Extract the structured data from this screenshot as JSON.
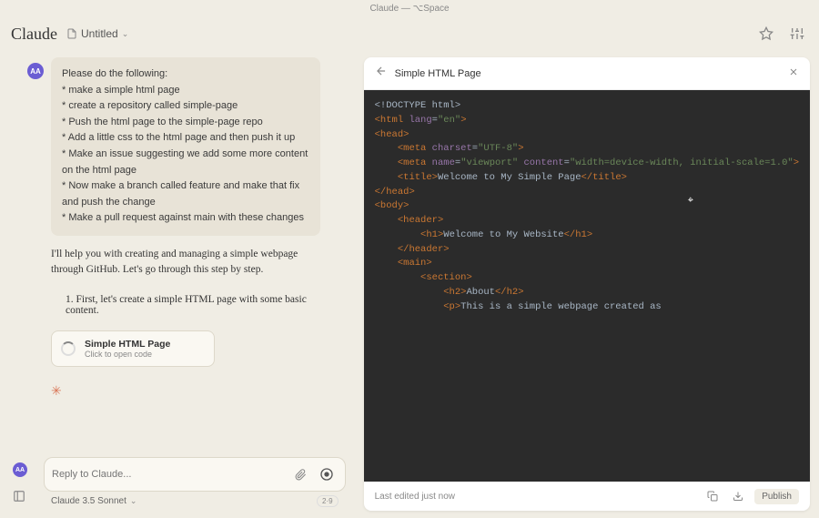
{
  "window_title": "Claude — ⌥Space",
  "header": {
    "logo": "Claude",
    "doc_title": "Untitled"
  },
  "user_message": {
    "avatar": "AA",
    "intro": "Please do the following:",
    "items": [
      "* make a simple html page",
      "* create a repository called simple-page",
      "* Push the html page to the simple-page repo",
      "* Add a little css to the html page and then push it up",
      "* Make an issue suggesting we add some more content on the html page",
      "* Now make a branch called feature and make that fix and push the change",
      "* Make a pull request against main with these changes"
    ]
  },
  "assistant": {
    "p1": "I'll help you with creating and managing a simple webpage through GitHub. Let's go through this step by step.",
    "list_item_1": "1. First, let's create a simple HTML page with some basic content."
  },
  "code_card": {
    "title": "Simple HTML Page",
    "subtitle": "Click to open code"
  },
  "composer": {
    "placeholder": "Reply to Claude...",
    "avatar": "AA",
    "model": "Claude 3.5 Sonnet",
    "count": "2·9"
  },
  "panel": {
    "title": "Simple HTML Page",
    "footer": "Last edited just now",
    "publish": "Publish"
  },
  "code": {
    "l1_a": "<!DOCTYPE html>",
    "l2_a": "<",
    "l2_b": "html",
    "l2_c": " lang",
    "l2_d": "=",
    "l2_e": "\"en\"",
    "l2_f": ">",
    "l3_a": "<",
    "l3_b": "head",
    "l3_c": ">",
    "l4_a": "<",
    "l4_b": "meta",
    "l4_c": " charset",
    "l4_d": "=",
    "l4_e": "\"UTF-8\"",
    "l4_f": ">",
    "l5_a": "<",
    "l5_b": "meta",
    "l5_c": " name",
    "l5_d": "=",
    "l5_e": "\"viewport\"",
    "l5_f": " content",
    "l5_g": "=",
    "l5_h": "\"width=device-width, initial-scale=1.0\"",
    "l5_i": ">",
    "l6_a": "<",
    "l6_b": "title",
    "l6_c": ">",
    "l6_d": "Welcome to My Simple Page",
    "l6_e": "</",
    "l6_f": "title",
    "l6_g": ">",
    "l7_a": "</",
    "l7_b": "head",
    "l7_c": ">",
    "l8_a": "<",
    "l8_b": "body",
    "l8_c": ">",
    "l9_a": "<",
    "l9_b": "header",
    "l9_c": ">",
    "l10_a": "<",
    "l10_b": "h1",
    "l10_c": ">",
    "l10_d": "Welcome to My Website",
    "l10_e": "</",
    "l10_f": "h1",
    "l10_g": ">",
    "l11_a": "</",
    "l11_b": "header",
    "l11_c": ">",
    "l12_a": "<",
    "l12_b": "main",
    "l12_c": ">",
    "l13_a": "<",
    "l13_b": "section",
    "l13_c": ">",
    "l14_a": "<",
    "l14_b": "h2",
    "l14_c": ">",
    "l14_d": "About",
    "l14_e": "</",
    "l14_f": "h2",
    "l14_g": ">",
    "l15_a": "<",
    "l15_b": "p",
    "l15_c": ">",
    "l15_d": "This is a simple webpage created as"
  }
}
